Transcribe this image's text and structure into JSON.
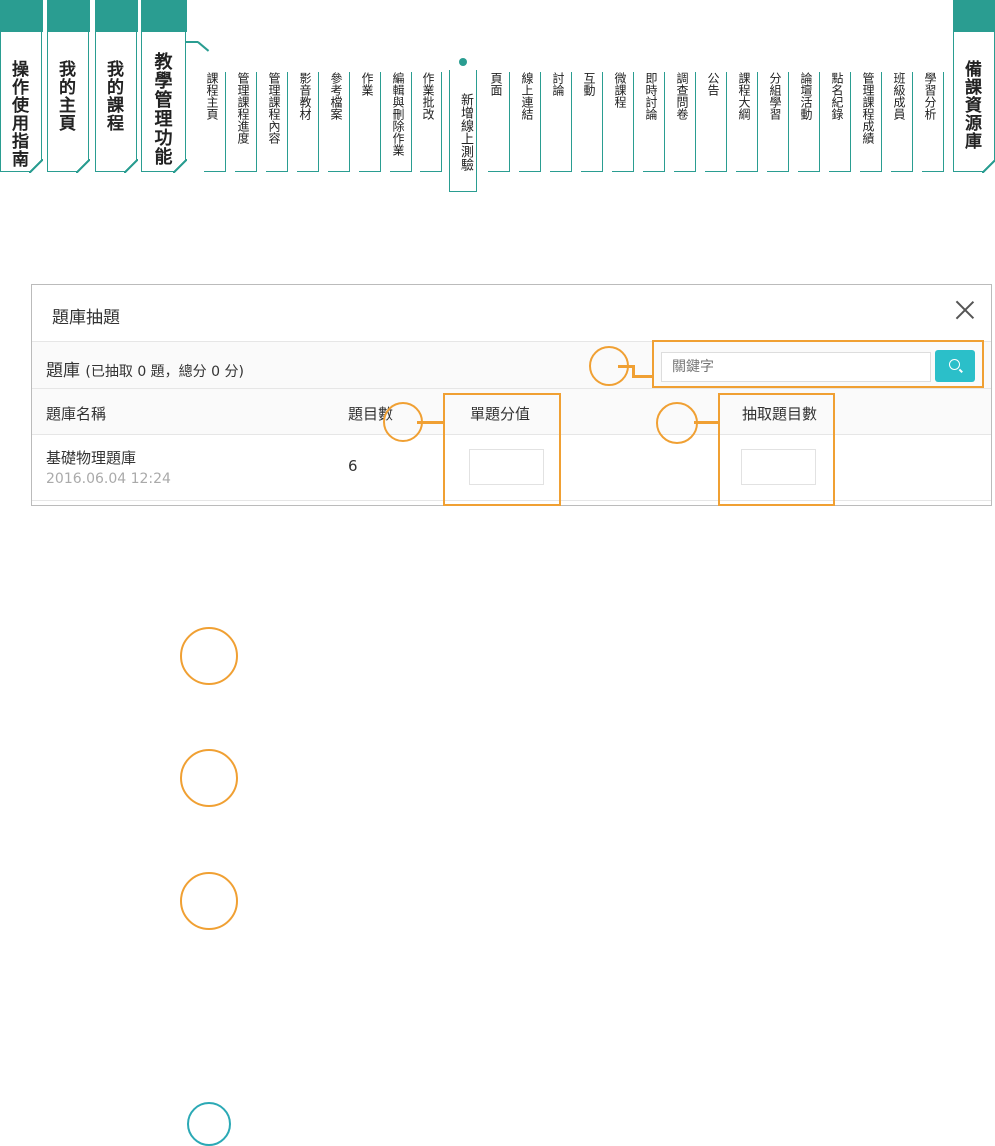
{
  "nav": {
    "left_tabs": [
      "操作使用指南",
      "我的主頁",
      "我的課程"
    ],
    "teach_tab": "教學管理功能",
    "sub_items": [
      "課程主頁",
      "管理課程進度",
      "管理課程內容",
      "影音教材",
      "參考檔案",
      "作業",
      "編輯與刪除作業",
      "作業批改"
    ],
    "active_item": "新增線上測驗",
    "sub_items_after": [
      "頁面",
      "線上連結",
      "討論",
      "互動",
      "微課程",
      "即時討論",
      "調查問卷",
      "公告",
      "課程大綱",
      "分組學習",
      "論壇活動",
      "點名紀錄",
      "管理課程成績",
      "班級成員",
      "學習分析"
    ],
    "right_tab": "備課資源庫"
  },
  "dialog": {
    "title": "題庫抽題",
    "bank_label": "題庫",
    "bank_summary": "(已抽取 0 題，總分 0 分)",
    "search_placeholder": "關鍵字",
    "columns": {
      "name": "題庫名稱",
      "count": "題目數",
      "score": "單題分值",
      "draw": "抽取題目數"
    },
    "rows": [
      {
        "name": "基礎物理題庫",
        "date": "2016.06.04 12:24",
        "count": "6"
      }
    ]
  },
  "colors": {
    "teal": "#2a9d91",
    "search_button": "#2bbfc9",
    "annotation": "#f0a033"
  },
  "icons": {
    "search": "search-icon",
    "close": "close-icon"
  }
}
